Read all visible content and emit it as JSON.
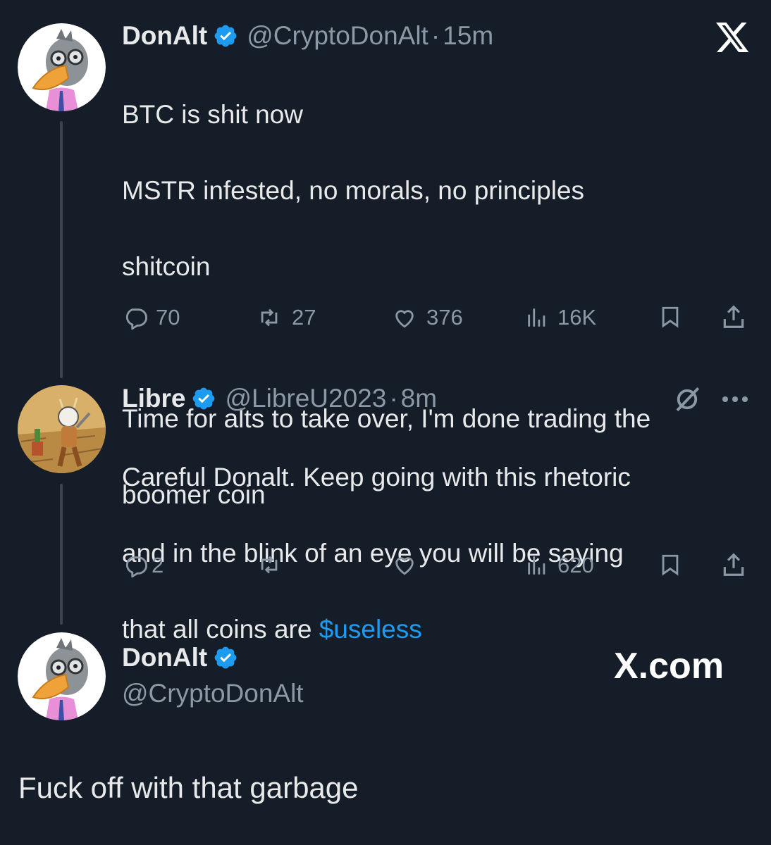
{
  "tweet1": {
    "name": "DonAlt",
    "handle": "@CryptoDonAlt",
    "time": "15m",
    "text_lines": [
      "BTC is shit now",
      "MSTR infested, no morals, no principles",
      "shitcoin",
      "",
      "Time for alts to take over, I'm done trading the",
      "boomer coin"
    ],
    "replies": "70",
    "reposts": "27",
    "likes": "376",
    "views": "16K"
  },
  "tweet2": {
    "name": "Libre",
    "handle": "@LibreU2023",
    "time": "8m",
    "text_line1": "Careful Donalt. Keep going with this rhetoric",
    "text_line2": "and in the blink of an eye you will be saying",
    "text_line3_prefix": "that all coins are ",
    "cashtag": "$useless",
    "replies": "2",
    "views": "620"
  },
  "reply_card": {
    "name": "DonAlt",
    "handle": "@CryptoDonAlt",
    "brand": "X.com",
    "text": "Fuck off with that garbage"
  },
  "separator": "·",
  "colors": {
    "background": "#151d28",
    "text": "#e7e9ea",
    "muted": "#8b98a5",
    "accent": "#1d9bf0"
  },
  "icons": [
    "verified-badge-icon",
    "x-logo-icon",
    "reply-icon",
    "repost-icon",
    "like-icon",
    "views-icon",
    "bookmark-icon",
    "share-icon",
    "grok-icon",
    "more-icon"
  ]
}
